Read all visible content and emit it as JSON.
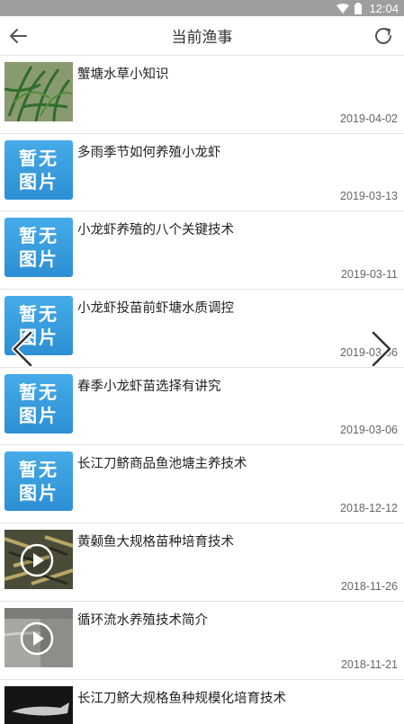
{
  "status_bar": {
    "time": "12:04"
  },
  "app_bar": {
    "title": "当前渔事"
  },
  "placeholder": {
    "line1": "暂无",
    "line2": "图片"
  },
  "articles": [
    {
      "title": "蟹塘水草小知识",
      "date": "2019-04-02",
      "thumb": "photo-plants"
    },
    {
      "title": "多雨季节如何养殖小龙虾",
      "date": "2019-03-13",
      "thumb": "placeholder"
    },
    {
      "title": "小龙虾养殖的八个关键技术",
      "date": "2019-03-11",
      "thumb": "placeholder"
    },
    {
      "title": "小龙虾投苗前虾塘水质调控",
      "date": "2019-03-06",
      "thumb": "placeholder"
    },
    {
      "title": "春季小龙虾苗选择有讲究",
      "date": "2019-03-06",
      "thumb": "placeholder"
    },
    {
      "title": "长江刀鲚商品鱼池塘主养技术",
      "date": "2018-12-12",
      "thumb": "placeholder"
    },
    {
      "title": "黄颡鱼大规格苗种培育技术",
      "date": "2018-11-26",
      "thumb": "video-fish"
    },
    {
      "title": "循环流水养殖技术简介",
      "date": "2018-11-21",
      "thumb": "video-tank"
    },
    {
      "title": "长江刀鲚大规格鱼种规模化培育技术",
      "date": "",
      "thumb": "photo-fish-dark"
    }
  ],
  "icons": {
    "back": "arrow-left-icon",
    "refresh": "refresh-icon",
    "prev": "chevron-left-icon",
    "next": "chevron-right-icon",
    "play": "play-icon"
  },
  "colors": {
    "status_bar": "#9e9e9e",
    "placeholder_blue": "#2c8fd4"
  }
}
